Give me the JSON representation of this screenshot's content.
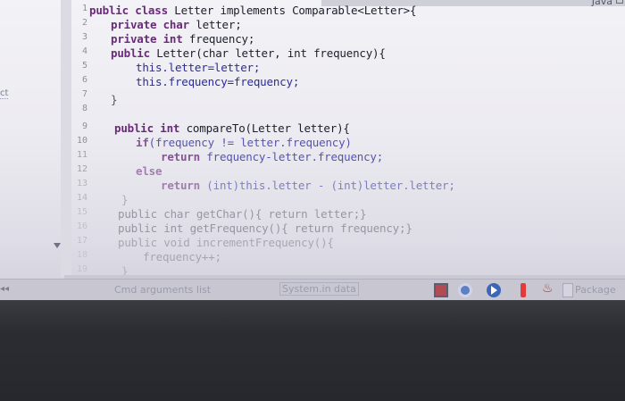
{
  "window": {
    "title": "Java"
  },
  "left_panel": {
    "tab_label": "ct"
  },
  "editor": {
    "line_numbers": [
      "1",
      "2",
      "3",
      "4",
      "5",
      "6",
      "7",
      "8",
      "9",
      "10",
      "11",
      "12",
      "13",
      "14",
      "15",
      "16",
      "17",
      "18",
      "19"
    ],
    "lines": {
      "l1_kw": "public class",
      "l1_rest": " Letter implements Comparable<Letter>{",
      "l2_kw": "private char",
      "l2_rest": " letter;",
      "l3_kw": "private int",
      "l3_rest": " frequency;",
      "l4_kw": "public",
      "l4_rest": " Letter(char letter, int frequency){",
      "l5": "this.letter=letter;",
      "l6": "this.frequency=frequency;",
      "l7": "}",
      "l9_kw": "public int",
      "l9_rest": " compareTo(Letter letter){",
      "l10_kw": "if",
      "l10_rest": "(frequency != letter.frequency)",
      "l11_kw": "return",
      "l11_rest": " frequency-letter.frequency;",
      "l12": "else",
      "l13_kw": "return",
      "l13_rest": " (int)this.letter - (int)letter.letter;",
      "l14": "}",
      "l15": "public char getChar(){ return letter;}",
      "l16": "public int getFrequency(){ return frequency;}",
      "l17": "public void incrementFrequency(){",
      "l18": "frequency++;",
      "l19": "}"
    }
  },
  "bottom_tabs": {
    "cmd": "Cmd arguments list",
    "system": "System.in data",
    "package": "Package"
  },
  "icons": [
    "gear-icon",
    "target-icon",
    "play-icon",
    "warning-icon",
    "java-icon",
    "package-icon"
  ],
  "colors": {
    "keyword": "#6a2a7a",
    "field": "#2a2ba0",
    "background": "#f3f2f6"
  }
}
